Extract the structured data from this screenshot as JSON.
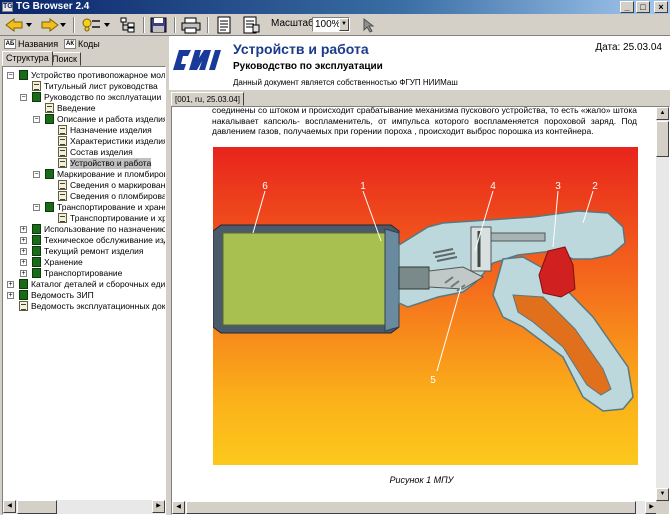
{
  "window": {
    "title": "TG Browser 2.4",
    "app_icon_text": "TG",
    "minimize": "_",
    "maximize": "□",
    "close": "×"
  },
  "toolbar": {
    "zoom_label": "Масштаб:",
    "zoom_value": "100%"
  },
  "left_panel": {
    "toggles": {
      "names_label": "Названия",
      "names_icon": "АБ",
      "codes_label": "Коды",
      "codes_icon": "АК"
    },
    "tabs": {
      "structure": "Структура",
      "search": "Поиск"
    },
    "tree": [
      {
        "label": "Устройство противопожарное мологабаритное",
        "expanded": true
      },
      {
        "label": "Титульный лист руководства"
      },
      {
        "label": "Руководство по эксплуатации",
        "expanded": true
      },
      {
        "label": "Введение"
      },
      {
        "label": "Описание и работа изделия",
        "expanded": true
      },
      {
        "label": "Назначение изделия"
      },
      {
        "label": "Характеристики изделия"
      },
      {
        "label": "Состав изделия"
      },
      {
        "label": "Устройство и работа",
        "selected": true
      },
      {
        "label": "Маркирование и пломбирование",
        "expanded": true
      },
      {
        "label": "Сведения о маркировании"
      },
      {
        "label": "Сведения о пломбировании"
      },
      {
        "label": "Транспортирование и хранение",
        "expanded": true
      },
      {
        "label": "Транспортирование и хранение"
      },
      {
        "label": "Использование по назначению",
        "expanded": false
      },
      {
        "label": "Техническое обслуживание изделия",
        "expanded": false
      },
      {
        "label": "Текущий ремонт изделия",
        "expanded": false
      },
      {
        "label": "Хранение",
        "expanded": false
      },
      {
        "label": "Транспортирование",
        "expanded": false
      },
      {
        "label": "Каталог деталей и сборочных единиц",
        "expanded": false
      },
      {
        "label": "Ведомость ЗИП",
        "expanded": false
      },
      {
        "label": "Ведомость эксплуатационных документов"
      }
    ]
  },
  "document": {
    "title": "Устройств и работа",
    "subtitle": "Руководство по эксплуатации",
    "owner_note": "Данный документ является собственностью ФГУП НИИМаш",
    "date": "Дата: 25.03.04",
    "tab_label": "[001, ru, 25.03.04]",
    "paragraph": "соединены со штоком и происходит срабатывание механизма пускового устройства, то есть «жало» штока накалывает капсюль- воспламенитель, от импульса которого воспламеняется пороховой заряд. Под давлением газов, получаемых при горении пороха , происходит выброс порошка из контейнера.",
    "figure_callouts": [
      "6",
      "1",
      "4",
      "3",
      "2",
      "5"
    ],
    "caption": "Рисунок 1    МПУ"
  },
  "colors": {
    "titlebar_start": "#0a246a",
    "titlebar_end": "#a6caf0",
    "doc_title": "#1a3a8a",
    "figure_top": "#e8241c",
    "figure_bottom": "#fcc81c"
  }
}
